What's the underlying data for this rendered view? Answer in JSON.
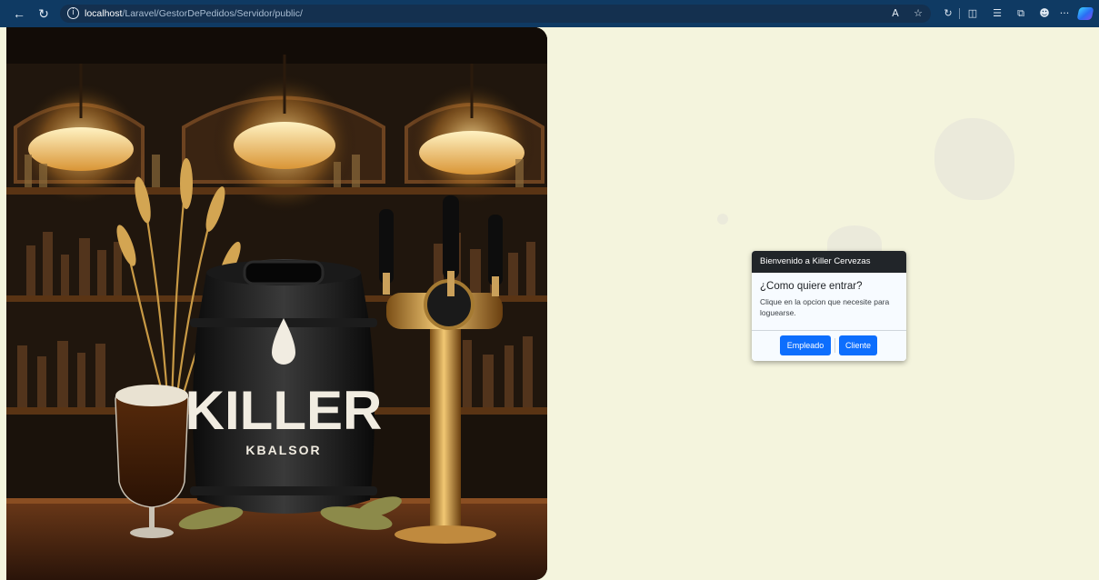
{
  "browser": {
    "url_host": "localhost",
    "url_path": "/Laravel/GestorDePedidos/Servidor/public/",
    "back_icon": "arrow-left-icon",
    "refresh_icon": "refresh-icon",
    "info_icon": "info-icon",
    "toolbar_icons": [
      "read-aloud-icon",
      "favorite-star-icon",
      "extensions-icon",
      "split-screen-icon",
      "favorites-list-icon",
      "collections-icon",
      "feedback-icon",
      "more-icon",
      "copilot-icon"
    ],
    "more_label": "···",
    "theme_color": "#0f3a63"
  },
  "hero": {
    "logo_text": "KILLER",
    "logo_subtext": "KBALSOR"
  },
  "dialog": {
    "header": "Bienvenido a Killer Cervezas",
    "title": "¿Como quiere entrar?",
    "text": "Clique en la opcion que necesite para loguearse.",
    "buttons": [
      {
        "label": "Empleado",
        "color": "#0d6efd"
      },
      {
        "label": "Cliente",
        "color": "#0d6efd"
      }
    ]
  },
  "colors": {
    "page_background": "#f4f4dd",
    "dialog_header": "#212529",
    "primary": "#0d6efd"
  }
}
